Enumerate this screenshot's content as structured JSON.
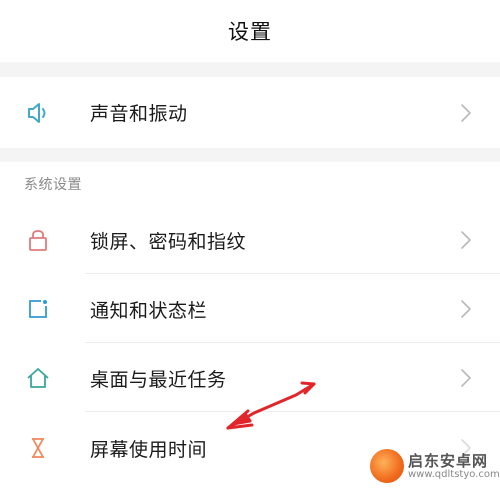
{
  "header": {
    "title": "设置"
  },
  "rows_top": [
    {
      "label": "声音和振动",
      "icon": "speaker-icon",
      "color": "#3fa9c7"
    }
  ],
  "section": {
    "title": "系统设置"
  },
  "rows_system": [
    {
      "label": "锁屏、密码和指纹",
      "icon": "lock-icon",
      "color": "#e07b7b"
    },
    {
      "label": "通知和状态栏",
      "icon": "notification-icon",
      "color": "#2f9bd1"
    },
    {
      "label": "桌面与最近任务",
      "icon": "home-icon",
      "color": "#3aa59a"
    },
    {
      "label": "屏幕使用时间",
      "icon": "hourglass-icon",
      "color": "#f08a5d"
    }
  ],
  "annotation": {
    "arrow_color": "#e0262b"
  },
  "watermark": {
    "title": "启东安卓网",
    "url": "www.qdltstyo.com"
  }
}
